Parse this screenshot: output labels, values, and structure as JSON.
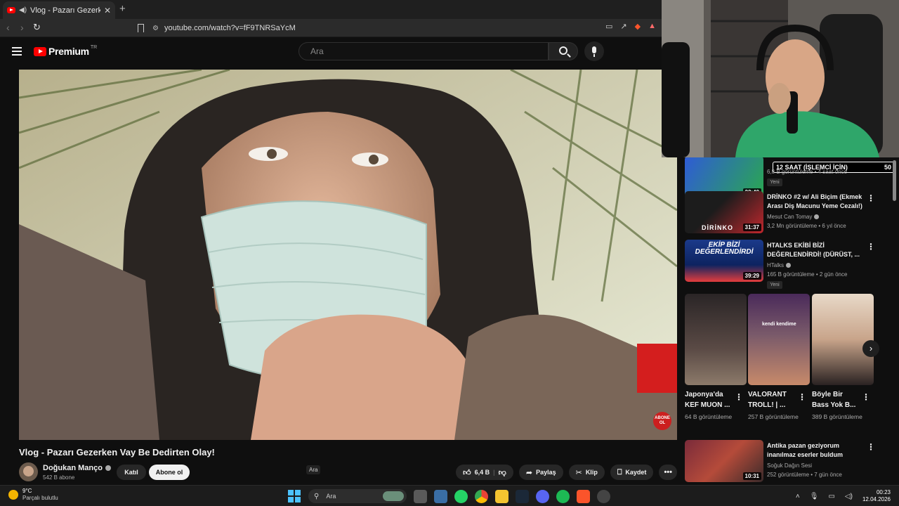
{
  "browser": {
    "tab_title": "Vlog - Pazarı Gezerken Vay Be Dedirten Olay!",
    "url": "youtube.com/watch?v=fF9TNRSaYcM"
  },
  "youtube": {
    "logo_text": "Premium",
    "logo_country": "TR",
    "search_placeholder": "Ara"
  },
  "video": {
    "title": "Vlog - Pazarı Gezerken Vay Be Dedirten Olay!",
    "channel": "Doğukan Manço",
    "subscribers": "542 B abone",
    "join_label": "Katıl",
    "subscribe_label": "Abone ol",
    "likes": "6,4 B",
    "share_label": "Paylaş",
    "clip_label": "Klip",
    "save_label": "Kaydet",
    "subscribe_watermark_line1": "ABONE",
    "subscribe_watermark_line2": "OL"
  },
  "tooltip": "Ara",
  "overlay": {
    "text": "12 SAAT (İŞLEMCİ İÇİN)",
    "number": "50"
  },
  "recommendations": [
    {
      "title": "",
      "channel": "",
      "meta": "6,8 B görüntüleme • 4 saat önce",
      "duration": "22:40",
      "badge": "Yeni",
      "thumb_text": "",
      "colors": [
        "#2f5bd6",
        "#2aa84f"
      ]
    },
    {
      "title": "DRİNKO #2 w/ Ali Biçim (Ekmek Arası Diş Macunu Yeme Cezalı!)",
      "channel": "Mesut Can Tomay",
      "meta": "3,2 Mn görüntüleme • 6 yıl önce",
      "duration": "31:37",
      "badge": "",
      "thumb_text": "DİRİNKO",
      "colors": [
        "#1c1c1c",
        "#c1272d"
      ]
    },
    {
      "title": "HTALKS EKİBİ BİZİ DEĞERLENDİRDİ! (DÜRÜST, ...",
      "channel": "HTalks",
      "meta": "165 B görüntüleme • 2 gün önce",
      "duration": "39:29",
      "badge": "Yeni",
      "thumb_text": "EKİP BİZİ DEĞERLENDİRDİ",
      "colors": [
        "#1b3a8a",
        "#e43d3d"
      ]
    },
    {
      "title": "Antika pazan geziyorum inanılmaz eserler buldum",
      "channel": "Soğuk Dağın Sesi",
      "meta": "252 görüntüleme • 7 gün önce",
      "duration": "10:31",
      "badge": "",
      "thumb_text": "",
      "colors": [
        "#7a2b3a",
        "#b54b3a"
      ]
    }
  ],
  "shorts": [
    {
      "title": "Japonya'da KEF MUON ...",
      "views": "64 B görüntüleme",
      "colors": [
        "#2a2526",
        "#5a4a45"
      ]
    },
    {
      "title": "VALORANT TROLL! | ...",
      "views": "257 B görüntüleme",
      "colors": [
        "#4a2a5a",
        "#c78a6a"
      ],
      "caption": "kendi kendime"
    },
    {
      "title": "Böyle Bir Bass Yok B...",
      "views": "389 B görüntüleme",
      "colors": [
        "#e8d9c8",
        "#2a2222"
      ]
    }
  ],
  "taskbar": {
    "temperature": "9°C",
    "weather": "Parçalı bulutlu",
    "search_label": "Ara",
    "time": "00:23",
    "date": "12.04.2026"
  },
  "colors": {
    "youtube_red": "#ff0000",
    "background": "#0f0f0f",
    "accent_blue": "#4cc2ff"
  }
}
